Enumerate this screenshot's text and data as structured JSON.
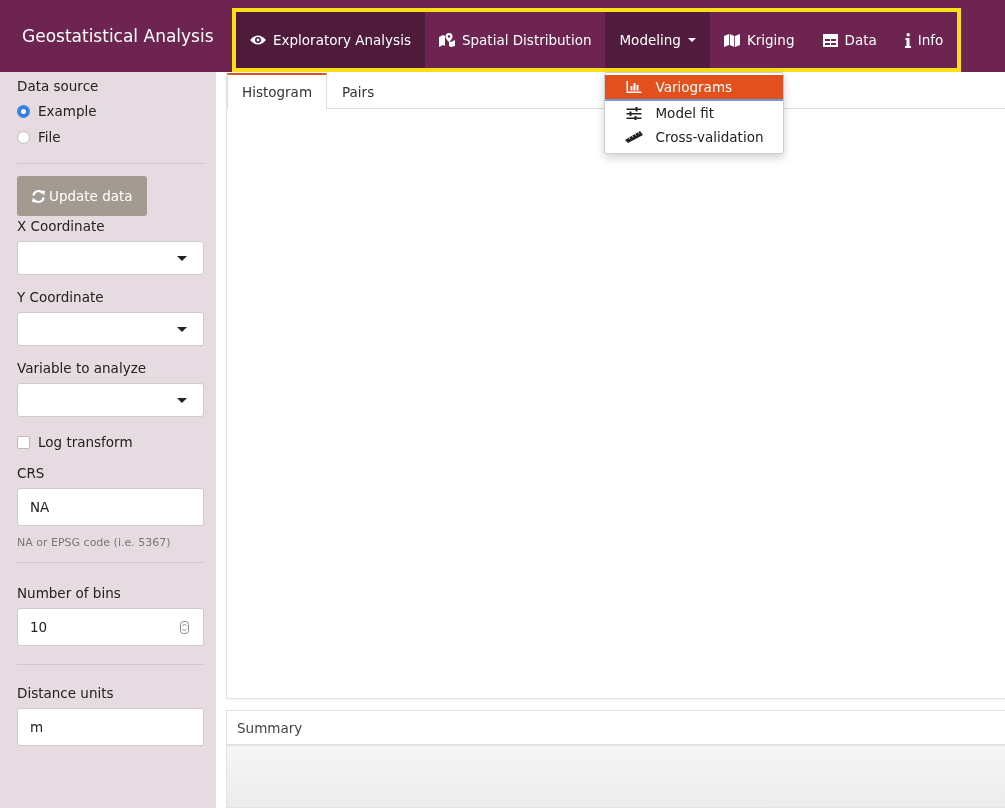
{
  "navbar": {
    "brand": "Geostatistical Analysis",
    "highlighted": true,
    "items": [
      {
        "label": "Exploratory Analysis",
        "kind": "link",
        "selected": true
      },
      {
        "label": "Spatial Distribution",
        "kind": "link",
        "selected": false
      },
      {
        "label": "Modeling",
        "kind": "dropdown",
        "selected": false,
        "expanded": true
      },
      {
        "label": "Kriging",
        "kind": "link",
        "selected": false
      },
      {
        "label": "Data",
        "kind": "link",
        "selected": false
      },
      {
        "label": "Info",
        "kind": "link",
        "selected": false
      }
    ]
  },
  "dropdown_menu": {
    "items": [
      {
        "label": "Variograms",
        "selected": true
      },
      {
        "label": "Model fit",
        "selected": false
      },
      {
        "label": "Cross-validation",
        "selected": false
      }
    ]
  },
  "sidebar": {
    "data_source": {
      "label": "Data source",
      "options": [
        {
          "label": "Example",
          "selected": true
        },
        {
          "label": "File",
          "selected": false
        }
      ]
    },
    "update_button": "Update data",
    "selects": [
      {
        "label": "X Coordinate"
      },
      {
        "label": "Y Coordinate"
      },
      {
        "label": "Variable to analyze"
      }
    ],
    "log_transform": {
      "label": "Log transform",
      "checked": false
    },
    "crs": {
      "label": "CRS",
      "value": "NA",
      "help": "NA or EPSG code (i.e. 5367)"
    },
    "bins": {
      "label": "Number of bins",
      "value": "10"
    },
    "units": {
      "label": "Distance units",
      "value": "m"
    }
  },
  "tabs": [
    {
      "label": "Histogram",
      "selected": true
    },
    {
      "label": "Pairs",
      "selected": false
    }
  ],
  "summary": {
    "title": "Summary"
  }
}
